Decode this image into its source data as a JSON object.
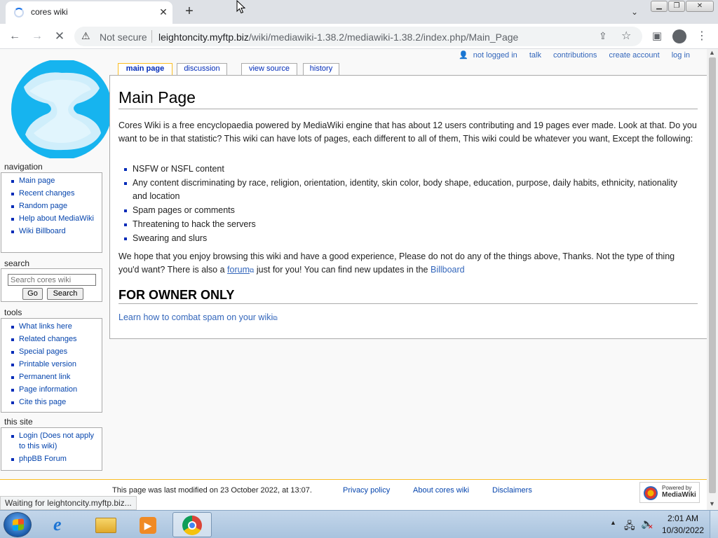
{
  "browser": {
    "tab_title": "cores wiki",
    "close_glyph": "✕",
    "new_tab_glyph": "+",
    "tab_search_glyph": "⌄",
    "min_glyph": "▁",
    "max_glyph": "❐",
    "close_win_glyph": "✕",
    "back_glyph": "←",
    "forward_glyph": "→",
    "stop_glyph": "✕",
    "warning_glyph": "⚠",
    "not_secure": "Not secure",
    "url_domain": "leightoncity.myftp.biz",
    "url_path": "/wiki/mediawiki-1.38.2/mediawiki-1.38.2/index.php/Main_Page",
    "share_glyph": "⇪",
    "star_glyph": "☆",
    "sidepanel_glyph": "▣",
    "menu_glyph": "⋮",
    "status": "Waiting for leightoncity.myftp.biz...",
    "icons": [
      "loading-spinner-icon",
      "warning-icon",
      "share-icon",
      "star-icon",
      "profile-icon"
    ]
  },
  "personal": {
    "user_glyph": "👤",
    "not_logged_in": "not logged in",
    "talk": "talk",
    "contributions": "contributions",
    "create_account": "create account",
    "log_in": "log in"
  },
  "tabs": {
    "main_page": "main page",
    "discussion": "discussion",
    "view_source": "view source",
    "history": "history"
  },
  "article": {
    "title": "Main Page",
    "intro": "Cores Wiki is a free encyclopaedia powered by MediaWiki engine that has about 12 users contributing and 19 pages ever made. Look at that. Do you want to be in that statistic? This wiki can have lots of pages, each different to all of them, This wiki could be whatever you want, Except the following:",
    "rules": [
      "NSFW or NSFL content",
      "Any content discriminating by race, religion, orientation, identity, skin color, body shape, education, purpose, daily habits, ethnicity, nationality and location",
      "Spam pages or comments",
      "Threatening to hack the servers",
      "Swearing and slurs"
    ],
    "closing_pre": "We hope that you enjoy browsing this wiki and have a good experience, Please do not do any of the things above, Thanks. Not the type of thing you'd want? There is also a ",
    "forum_link": "forum",
    "closing_mid": " just for you! You can find new updates in the ",
    "billboard_link": "Billboard",
    "owner_heading": "FOR OWNER ONLY",
    "combat_link": "Learn how to combat spam on your wiki",
    "ext_glyph": "⧉"
  },
  "sidebar": {
    "navigation_title": "navigation",
    "navigation": [
      "Main page",
      "Recent changes",
      "Random page",
      "Help about MediaWiki",
      "Wiki Billboard"
    ],
    "search_title": "search",
    "search_placeholder": "Search cores wiki",
    "go_label": "Go",
    "search_label": "Search",
    "tools_title": "tools",
    "tools": [
      "What links here",
      "Related changes",
      "Special pages",
      "Printable version",
      "Permanent link",
      "Page information",
      "Cite this page"
    ],
    "site_title": "this site",
    "site": [
      "Login (Does not apply to this wiki)",
      "phpBB Forum"
    ]
  },
  "footer": {
    "last_modified": "This page was last modified on 23 October 2022, at 13:07.",
    "privacy": "Privacy policy",
    "about": "About cores wiki",
    "disclaimers": "Disclaimers",
    "powered_by": "Powered by",
    "mediawiki": "MediaWiki"
  },
  "taskbar": {
    "ie_glyph": "e",
    "media_glyph": "▶",
    "tray_arrow": "▲",
    "network_glyph": "🖧",
    "volume_glyph": "🔈",
    "volume_mute": "✕",
    "time": "2:01 AM",
    "date": "10/30/2022"
  },
  "colors": {
    "link": "#0645ad",
    "tab_active_border": "#fabd23",
    "logo_blue": "#16b4ef",
    "logo_light": "#cfeefb"
  }
}
